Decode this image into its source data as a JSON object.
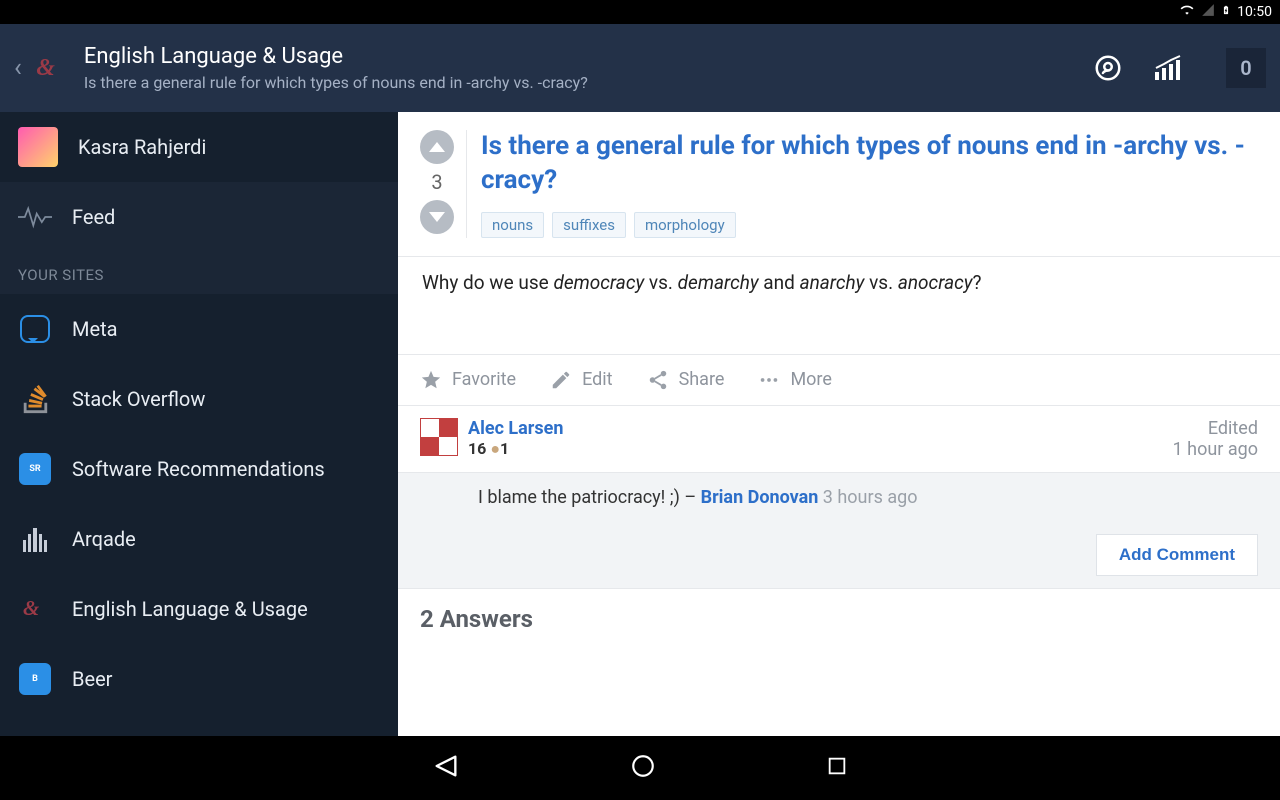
{
  "status": {
    "time": "10:50"
  },
  "header": {
    "site_title": "English Language & Usage",
    "subtitle": "Is there a general rule for which types of nouns end in -archy vs. -cracy?",
    "badge_count": "0"
  },
  "sidebar": {
    "user_name": "Kasra Rahjerdi",
    "feed_label": "Feed",
    "section_label": "YOUR SITES",
    "sites": [
      {
        "label": "Meta"
      },
      {
        "label": "Stack Overflow"
      },
      {
        "label": "Software Recommendations"
      },
      {
        "label": "Arqade"
      },
      {
        "label": "English Language & Usage"
      },
      {
        "label": "Beer"
      }
    ]
  },
  "question": {
    "title": "Is there a general rule for which types of nouns end in -archy vs. -cracy?",
    "score": "3",
    "tags": [
      "nouns",
      "suffixes",
      "morphology"
    ],
    "body_plain": "Why do we use ",
    "body_w1": "democracy",
    "body_mid1": " vs. ",
    "body_w2": "demarchy",
    "body_mid2": " and ",
    "body_w3": "anarchy",
    "body_mid3": " vs. ",
    "body_w4": "anocracy",
    "body_end": "?"
  },
  "actions": {
    "favorite": "Favorite",
    "edit": "Edit",
    "share": "Share",
    "more": "More"
  },
  "author": {
    "name": "Alec Larsen",
    "rep": "16",
    "bronze": "1",
    "edited_label": "Edited",
    "edited_time": "1 hour ago"
  },
  "comment": {
    "text": "I blame the patriocracy! ;) – ",
    "user": "Brian Donovan",
    "time": " 3 hours ago"
  },
  "add_comment": "Add Comment",
  "answers_count": "2 Answers"
}
